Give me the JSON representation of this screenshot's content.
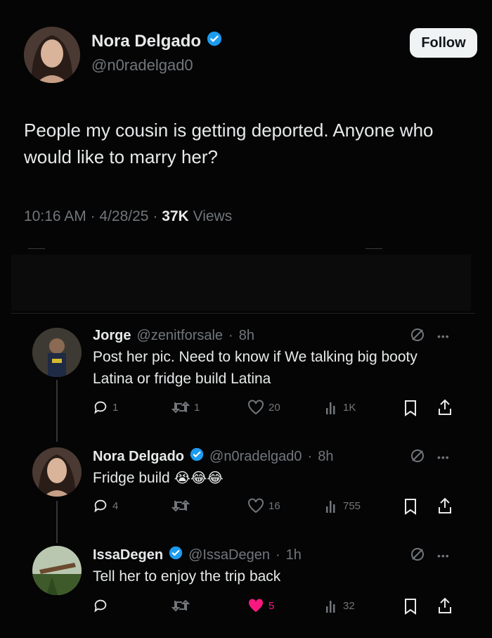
{
  "main_tweet": {
    "author_name": "Nora Delgado",
    "author_handle": "@n0radelgad0",
    "follow_label": "Follow",
    "text": "People my cousin is getting deported. Anyone who would like to marry her?",
    "time": "10:16 AM",
    "date": "4/28/25",
    "views_count": "37K",
    "views_label": "Views",
    "separator": "·"
  },
  "replies": [
    {
      "name": "Jorge",
      "handle": "@zenitforsale",
      "age": "8h",
      "verified": false,
      "text": "Post her pic. Need to know if We talking big booty Latina or fridge build Latina",
      "replies": "1",
      "reposts": "1",
      "likes": "20",
      "views": "1K",
      "liked": false
    },
    {
      "name": "Nora Delgado",
      "handle": "@n0radelgad0",
      "age": "8h",
      "verified": true,
      "text": "Fridge build",
      "emoji": "😭😂😂",
      "replies": "4",
      "reposts": "",
      "likes": "16",
      "views": "755",
      "liked": false
    },
    {
      "name": "IssaDegen",
      "handle": "@IssaDegen",
      "age": "1h",
      "verified": true,
      "text": "Tell her to enjoy the trip back",
      "replies": "",
      "reposts": "",
      "likes": "5",
      "views": "32",
      "liked": true
    }
  ],
  "colors": {
    "background": "#050505",
    "text": "#e7e9ea",
    "muted": "#71767b",
    "verified": "#1d9bf0",
    "like": "#f91880"
  },
  "icons": [
    "verified-icon",
    "reply-icon",
    "repost-icon",
    "like-icon",
    "views-icon",
    "bookmark-icon",
    "share-icon",
    "grok-icon",
    "more-icon"
  ]
}
